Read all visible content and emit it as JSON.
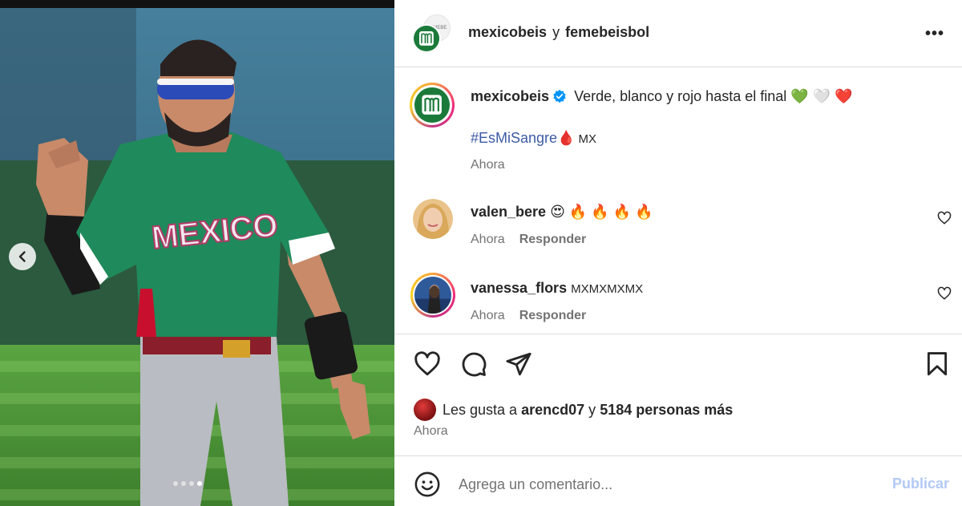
{
  "post": {
    "header": {
      "author_primary": "mexicobeis",
      "joiner": "y",
      "author_secondary": "femebeisbol",
      "secondary_avatar_text": "FEMEBE",
      "more_label": "•••"
    },
    "media": {
      "jersey_text": "MEXICO",
      "carousel_count": 4,
      "carousel_active_index": 0,
      "colors": {
        "jersey": "#1f8a5b",
        "pants": "#b9bcc2",
        "field": "#4f9a3a",
        "sky": "#3f6f8a"
      }
    },
    "caption": {
      "username": "mexicobeis",
      "text": "Verde, blanco y rojo hasta el final",
      "emojis": [
        "💚",
        "🤍",
        "❤️"
      ],
      "hashtag": "#EsMiSangre",
      "hashtag_emoji": "🩸",
      "suffix": "MX",
      "time": "Ahora"
    },
    "comments": [
      {
        "username": "valen_bere",
        "text": "😍 🔥 🔥 🔥 🔥",
        "time": "Ahora",
        "reply_label": "Responder"
      },
      {
        "username": "vanessa_flors",
        "text": "MXMXMXMX",
        "time": "Ahora",
        "reply_label": "Responder"
      }
    ],
    "likes": {
      "prefix": "Les gusta a",
      "liker": "arencd07",
      "joiner": "y",
      "count_text": "5184 personas más",
      "time": "Ahora"
    },
    "composer": {
      "placeholder": "Agrega un comentario...",
      "publish_label": "Publicar"
    },
    "brand": {
      "link_color": "#3c5ba5",
      "publish_disabled_color": "#b2c9f5",
      "logo_green": "#1b7a3a"
    },
    "icons": [
      "chevron-left-icon",
      "more-icon",
      "verified-icon",
      "heart-icon",
      "comment-icon",
      "share-icon",
      "bookmark-icon",
      "emoji-icon"
    ]
  }
}
